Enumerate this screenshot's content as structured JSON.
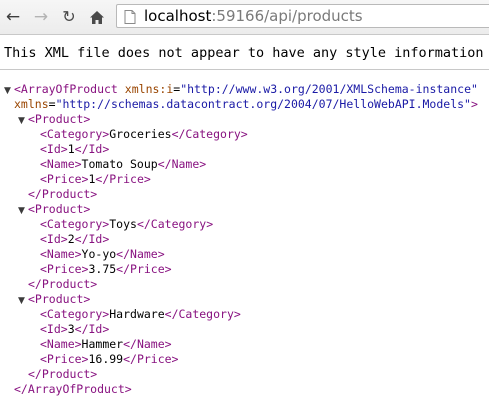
{
  "browser": {
    "url_host": "localhost",
    "url_rest": ":59166/api/products"
  },
  "banner": "This XML file does not appear to have any style information a",
  "xml": {
    "root_tag": "ArrayOfProduct",
    "ns_i_attr": "xmlns:i",
    "ns_i_value": "\"http://www.w3.org/2001/XMLSchema-instance\"",
    "ns_attr": "xmlns",
    "ns_value": "\"http://schemas.datacontract.org/2004/07/HelloWebAPI.Models\"",
    "product_tag": "Product",
    "field_tags": {
      "category": "Category",
      "id": "Id",
      "name": "Name",
      "price": "Price"
    },
    "products": [
      {
        "category": "Groceries",
        "id": "1",
        "name": "Tomato Soup",
        "price": "1"
      },
      {
        "category": "Toys",
        "id": "2",
        "name": "Yo-yo",
        "price": "3.75"
      },
      {
        "category": "Hardware",
        "id": "3",
        "name": "Hammer",
        "price": "16.99"
      }
    ]
  }
}
